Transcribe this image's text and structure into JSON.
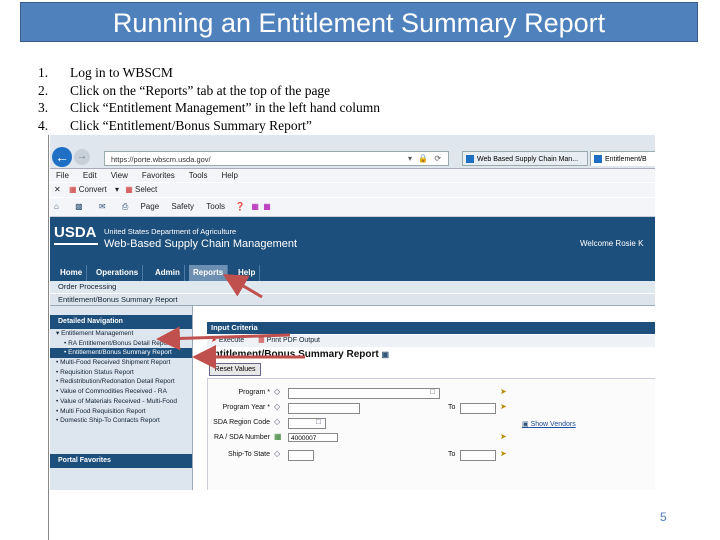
{
  "slide": {
    "title": "Running an Entitlement Summary Report",
    "steps": [
      {
        "num": "1.",
        "text": "Log in to WBSCM"
      },
      {
        "num": "2.",
        "text": "Click on the “Reports” tab at the top of the page"
      },
      {
        "num": "3.",
        "text": "Click “Entitlement Management” in the left hand column"
      },
      {
        "num": "4.",
        "text": "Click “Entitlement/Bonus Summary Report”"
      }
    ],
    "page_number": "5",
    "title_bg_color": "#4f81bd",
    "arrow_color": "#c0504d"
  },
  "browser": {
    "url": "https://porte.wbscm.usda.gov/",
    "tabs": [
      "Web Based Supply Chain Man...",
      "Entitlement/B"
    ],
    "menu": [
      "File",
      "Edit",
      "View",
      "Favorites",
      "Tools",
      "Help"
    ],
    "convert_label": "Convert",
    "select_label": "Select",
    "command_items": [
      "Page",
      "Safety",
      "Tools"
    ]
  },
  "site": {
    "logo": "USDA",
    "dept": "United States Department of Agriculture",
    "system": "Web-Based Supply Chain Management",
    "welcome": "Welcome Rosie K",
    "nav": [
      "Home",
      "Operations",
      "Admin",
      "Reports",
      "Help"
    ],
    "active_nav": "Reports",
    "subnav": "Order Processing",
    "breadcrumb": "Entitlement/Bonus Summary Report"
  },
  "sidebar": {
    "heading": "Detailed Navigation",
    "items": [
      {
        "label": "Entitlement Management",
        "sub": false,
        "hl": false,
        "prefix": "▾"
      },
      {
        "label": "RA Entitlement/Bonus Detail Report",
        "sub": true,
        "hl": false,
        "prefix": "•"
      },
      {
        "label": "Entitlement/Bonus Summary Report",
        "sub": true,
        "hl": true,
        "prefix": "•"
      },
      {
        "label": "Multi-Food Received Shipment Report",
        "sub": false,
        "hl": false,
        "prefix": "•"
      },
      {
        "label": "Requisition Status Report",
        "sub": false,
        "hl": false,
        "prefix": "•"
      },
      {
        "label": "Redistribution/Redonation Detail Report",
        "sub": false,
        "hl": false,
        "prefix": "•"
      },
      {
        "label": "Value of Commodities Received - RA",
        "sub": false,
        "hl": false,
        "prefix": "•"
      },
      {
        "label": "Value of Materials Received - Multi-Food",
        "sub": false,
        "hl": false,
        "prefix": "•"
      },
      {
        "label": "Multi Food Requisition Report",
        "sub": false,
        "hl": false,
        "prefix": "•"
      },
      {
        "label": "Domestic Ship-To Contacts Report",
        "sub": false,
        "hl": false,
        "prefix": "•"
      }
    ],
    "footer": "Portal Favorites"
  },
  "main": {
    "criteria_heading": "Input Criteria",
    "execute_label": "Execute",
    "print_label": "Print PDF Output",
    "report_title": "Entitlement/Bonus Summary Report",
    "reset_label": "Reset Values",
    "show_vendors": "Show Vendors",
    "fields": [
      {
        "label": "Program *",
        "value": ""
      },
      {
        "label": "Program Year *",
        "value": "",
        "to": "To"
      },
      {
        "label": "SDA Region Code",
        "value": ""
      },
      {
        "label": "RA / SDA Number",
        "value": "4000007"
      },
      {
        "label": "Ship-To State",
        "value": "",
        "to": "To"
      }
    ]
  }
}
